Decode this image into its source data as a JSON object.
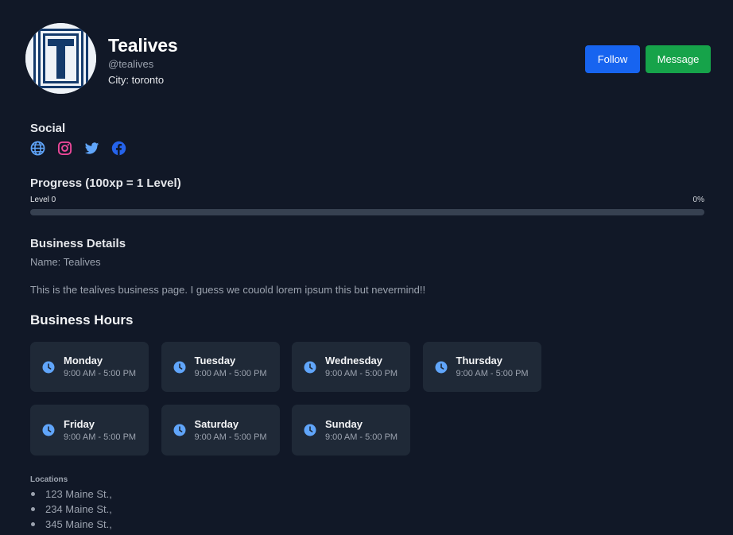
{
  "profile": {
    "name": "Tealives",
    "handle": "@tealives",
    "city": "City: toronto",
    "avatar_letter": "T"
  },
  "actions": {
    "follow_label": "Follow",
    "message_label": "Message"
  },
  "social": {
    "title": "Social",
    "icons": [
      "globe-icon",
      "instagram-icon",
      "twitter-icon",
      "facebook-icon"
    ]
  },
  "progress": {
    "title": "Progress (100xp = 1 Level)",
    "level_label": "Level 0",
    "percent_label": "0%",
    "percent_value": 0
  },
  "details": {
    "title": "Business Details",
    "name_line": "Name: Tealives",
    "description": "This is the tealives business page. I guess we couold lorem ipsum this but nevermind!!"
  },
  "hours": {
    "title": "Business Hours",
    "days": [
      {
        "day": "Monday",
        "time": "9:00 AM - 5:00 PM"
      },
      {
        "day": "Tuesday",
        "time": "9:00 AM - 5:00 PM"
      },
      {
        "day": "Wednesday",
        "time": "9:00 AM - 5:00 PM"
      },
      {
        "day": "Thursday",
        "time": "9:00 AM - 5:00 PM"
      },
      {
        "day": "Friday",
        "time": "9:00 AM - 5:00 PM"
      },
      {
        "day": "Saturday",
        "time": "9:00 AM - 5:00 PM"
      },
      {
        "day": "Sunday",
        "time": "9:00 AM - 5:00 PM"
      }
    ]
  },
  "locations": {
    "title": "Locations",
    "items": [
      "123 Maine St.,",
      "234 Maine St.,",
      "345 Maine St.,"
    ]
  },
  "colors": {
    "background": "#111827",
    "card": "#1f2937",
    "follow": "#1764f0",
    "message": "#16a34a",
    "accent_blue": "#60a5fa",
    "instagram": "#ec4899",
    "twitter": "#60a5fa",
    "facebook": "#2563eb"
  }
}
